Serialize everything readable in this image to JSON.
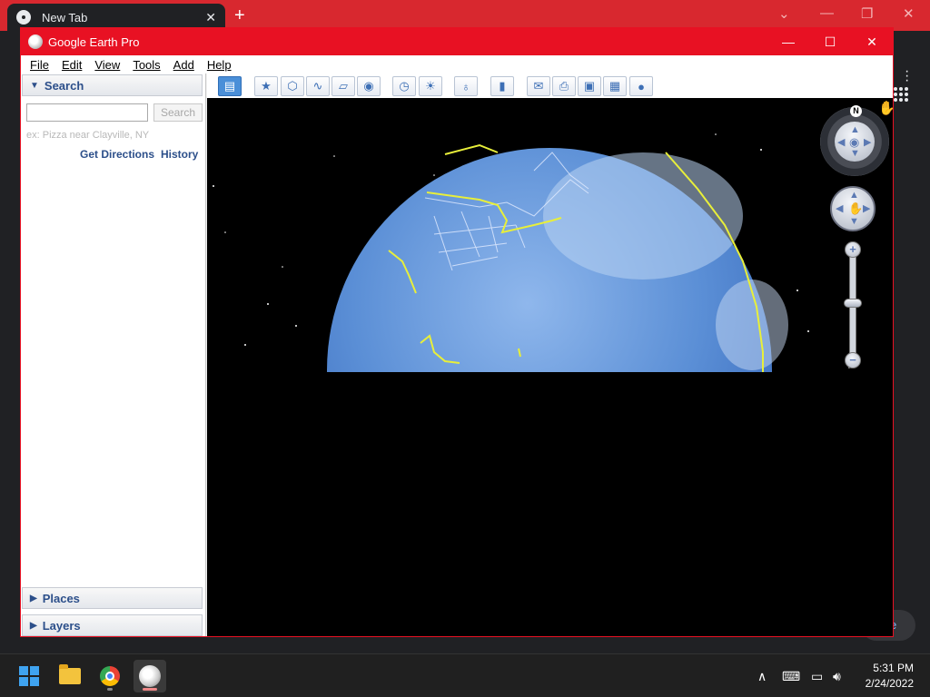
{
  "chrome": {
    "tab_title": "New Tab",
    "tab_close": "✕",
    "new_tab": "+",
    "controls": [
      "⌄",
      "—",
      "❐",
      "✕"
    ],
    "bottom_pill_text": "e"
  },
  "earth": {
    "window_title": "Google Earth Pro",
    "window_controls": [
      "—",
      "☐",
      "✕"
    ],
    "menu": [
      "File",
      "Edit",
      "View",
      "Tools",
      "Add",
      "Help"
    ],
    "search": {
      "header": "Search",
      "input_value": "",
      "button": "Search",
      "hint": "ex: Pizza near Clayville, NY",
      "get_directions": "Get Directions",
      "history": "History"
    },
    "places_header": "Places",
    "layers_header": "Layers",
    "toolbar_icons": [
      "sidebar-toggle-icon",
      "placemark-icon",
      "polygon-icon",
      "path-icon",
      "image-overlay-icon",
      "record-tour-icon",
      "historical-imagery-icon",
      "sunlight-icon",
      "planet-icon",
      "ruler-icon",
      "email-icon",
      "print-icon",
      "save-image-icon",
      "view-in-maps-icon",
      "earth-icon"
    ],
    "compass_north": "N",
    "zoom_in": "+",
    "zoom_out": "−"
  },
  "taskbar": {
    "apps": [
      "start-icon",
      "file-explorer-icon",
      "chrome-icon",
      "google-earth-icon"
    ],
    "tray_icons": [
      "chevron-up-icon",
      "keyboard-icon",
      "network-icon",
      "volume-icon"
    ],
    "time": "5:31 PM",
    "date": "2/24/2022"
  },
  "colors": {
    "chrome_red": "#d8282f",
    "window_accent": "#e81123",
    "globe_blue": "#5b8fd6",
    "border_yellow": "#e8ef3a"
  }
}
